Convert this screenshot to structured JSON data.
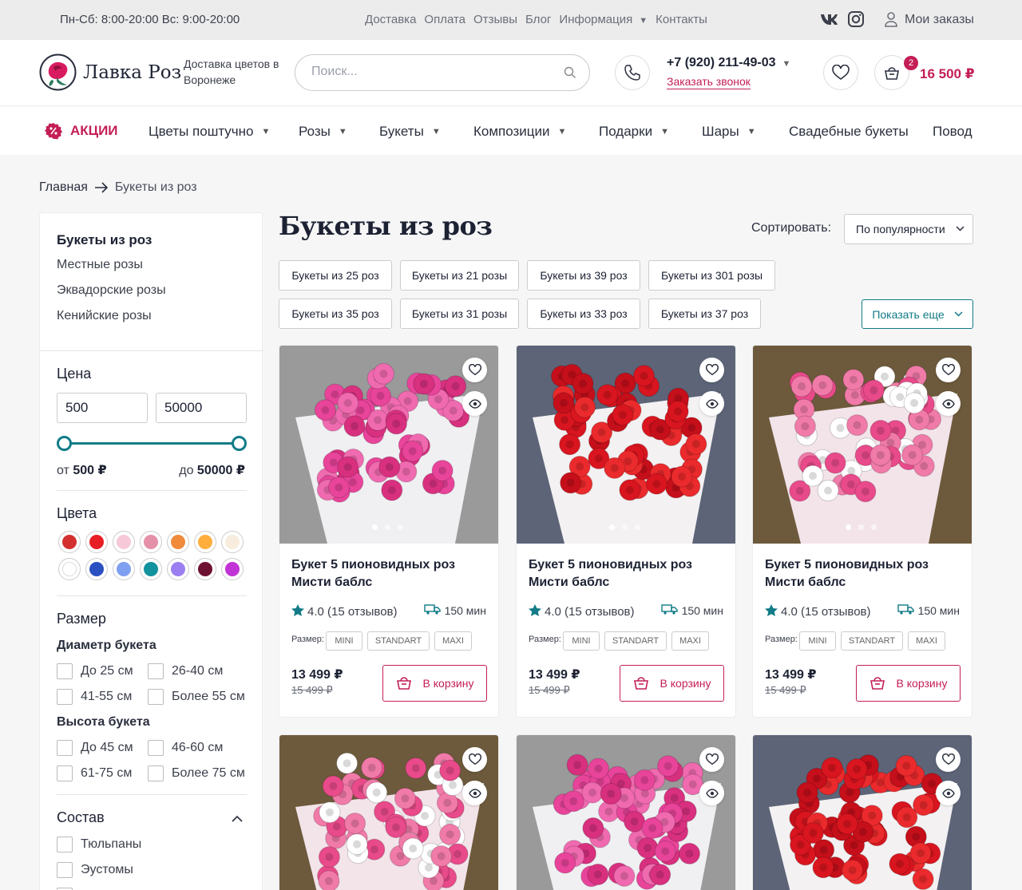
{
  "topbar": {
    "hours": "Пн-Сб: 8:00-20:00 Вс: 9:00-20:00",
    "nav": [
      "Доставка",
      "Оплата",
      "Отзывы",
      "Блог",
      "Информация",
      "Контакты"
    ],
    "orders": "Мои заказы",
    "icons": [
      "vk-icon",
      "instagram-icon",
      "user-icon"
    ]
  },
  "header": {
    "logo_text": "Лавка Роз",
    "tagline": "Доставка цветов в Воронеже",
    "search_placeholder": "Поиск...",
    "phone": "+7 (920) 211-49-03",
    "callback": "Заказать звонок",
    "cart_count": "2",
    "cart_total": "16 500 ₽"
  },
  "mainnav": {
    "promo": "АКЦИИ",
    "items": [
      "Цветы поштучно",
      "Розы",
      "Букеты",
      "Композиции",
      "Подарки",
      "Шары",
      "Свадебные букеты",
      "Повод"
    ]
  },
  "breadcrumbs": {
    "home": "Главная",
    "current": "Букеты из роз"
  },
  "sidebar": {
    "categories": [
      "Букеты из роз",
      "Местные розы",
      "Эквадорские розы",
      "Кенийские розы"
    ],
    "price_title": "Цена",
    "price_min": "500",
    "price_max": "50000",
    "from_label": "от",
    "from_value": "500 ₽",
    "to_label": "до",
    "to_value": "50000 ₽",
    "colors_title": "Цвета",
    "colors": [
      "#d32f2f",
      "#e81e25",
      "#f6c8d8",
      "#e58fa8",
      "#f08a3c",
      "#ffae3d",
      "#f7ecdd",
      "#ffffff",
      "#2a4fc0",
      "#7f9ff0",
      "#12929e",
      "#9b7ff0",
      "#6e1032",
      "#c233d6"
    ],
    "size_title": "Размер",
    "diameter_title": "Диаметр букета",
    "diameters": [
      "До 25 см",
      "26-40 см",
      "41-55 см",
      "Более 55 см"
    ],
    "height_title": "Высота букета",
    "heights": [
      "До 45 см",
      "46-60 см",
      "61-75 см",
      "Более 75 см"
    ],
    "composition_title": "Состав",
    "compositions": [
      "Тюльпаны",
      "Эустомы"
    ]
  },
  "main": {
    "title": "Букеты из роз",
    "sort_label": "Сортировать:",
    "sort_value": "По популярности",
    "chips_row1": [
      "Букеты из 25 роз",
      "Букеты из 21 розы",
      "Букеты из 39 роз",
      "Букеты из 301 розы"
    ],
    "chips_row2": [
      "Букеты из 35 роз",
      "Букеты из 31 розы",
      "Букеты из 33 роз",
      "Букеты из 37 роз"
    ],
    "show_more": "Показать еще"
  },
  "products": [
    {
      "name": "Букет 5 пионовидных роз Мисти баблс",
      "rating": "4.0 (15 отзывов)",
      "delivery": "150 мин",
      "size_label": "Размер:",
      "sizes": [
        "MINI",
        "STANDART",
        "MAXI"
      ],
      "price": "13 499 ₽",
      "old_price": "15 499 ₽",
      "buy": "В корзину",
      "color": "pink"
    },
    {
      "name": "Букет 5 пионовидных роз Мисти баблс",
      "rating": "4.0 (15 отзывов)",
      "delivery": "150 мин",
      "size_label": "Размер:",
      "sizes": [
        "MINI",
        "STANDART",
        "MAXI"
      ],
      "price": "13 499 ₽",
      "old_price": "15 499 ₽",
      "buy": "В корзину",
      "color": "red"
    },
    {
      "name": "Букет 5 пионовидных роз Мисти баблс",
      "rating": "4.0 (15 отзывов)",
      "delivery": "150 мин",
      "size_label": "Размер:",
      "sizes": [
        "MINI",
        "STANDART",
        "MAXI"
      ],
      "price": "13 499 ₽",
      "old_price": "15 499 ₽",
      "buy": "В корзину",
      "color": "mixed"
    }
  ],
  "colors": {
    "accent": "#c41e55",
    "teal": "#127b87"
  }
}
